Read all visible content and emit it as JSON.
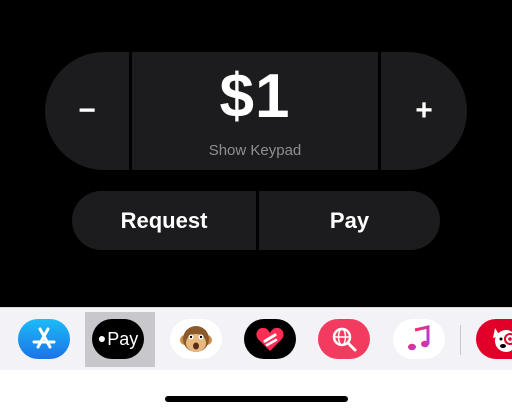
{
  "stepper": {
    "decrement_label": "−",
    "amount": "$1",
    "keypad_label": "Show Keypad",
    "increment_label": "+"
  },
  "actions": {
    "request_label": "Request",
    "pay_label": "Pay"
  },
  "drawer": {
    "apps": [
      {
        "name": "App Store",
        "icon": "app-store-icon"
      },
      {
        "name": "Apple Pay",
        "icon": "apple-pay-icon",
        "label": "Pay",
        "selected": true
      },
      {
        "name": "Animoji",
        "icon": "monkey-icon"
      },
      {
        "name": "Digital Touch",
        "icon": "heart-icon"
      },
      {
        "name": "Images Search",
        "icon": "globe-search-icon"
      },
      {
        "name": "Music",
        "icon": "music-note-icon"
      },
      {
        "name": "Sticker App",
        "icon": "dog-icon"
      }
    ]
  },
  "colors": {
    "background": "#000000",
    "button": "#1c1c1e",
    "secondary_text": "#8e8e93",
    "drawer": "#f2f2f7"
  }
}
